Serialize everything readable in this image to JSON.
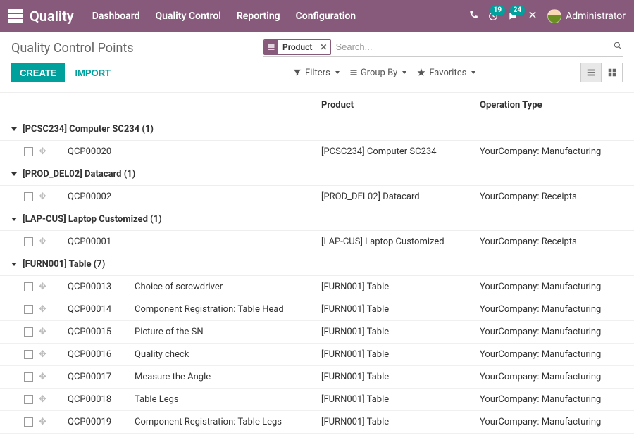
{
  "navbar": {
    "brand": "Quality",
    "menu": [
      "Dashboard",
      "Quality Control",
      "Reporting",
      "Configuration"
    ],
    "badge_activities": "19",
    "badge_messages": "24",
    "user_name": "Administrator"
  },
  "page": {
    "title": "Quality Control Points",
    "facet_label": "Product",
    "search_placeholder": "Search..."
  },
  "buttons": {
    "create": "CREATE",
    "import": "IMPORT",
    "filters": "Filters",
    "group_by": "Group By",
    "favorites": "Favorites"
  },
  "columns": {
    "product": "Product",
    "operation_type": "Operation Type"
  },
  "groups": [
    {
      "label": "[PCSC234] Computer SC234 (1)",
      "rows": [
        {
          "ref": "QCP00020",
          "title": "",
          "product": "[PCSC234] Computer SC234",
          "op": "YourCompany: Manufacturing"
        }
      ]
    },
    {
      "label": "[PROD_DEL02] Datacard (1)",
      "rows": [
        {
          "ref": "QCP00002",
          "title": "",
          "product": "[PROD_DEL02] Datacard",
          "op": "YourCompany: Receipts"
        }
      ]
    },
    {
      "label": "[LAP-CUS] Laptop Customized (1)",
      "rows": [
        {
          "ref": "QCP00001",
          "title": "",
          "product": "[LAP-CUS] Laptop Customized",
          "op": "YourCompany: Receipts"
        }
      ]
    },
    {
      "label": "[FURN001] Table (7)",
      "rows": [
        {
          "ref": "QCP00013",
          "title": "Choice of screwdriver",
          "product": "[FURN001] Table",
          "op": "YourCompany: Manufacturing"
        },
        {
          "ref": "QCP00014",
          "title": "Component Registration: Table Head",
          "product": "[FURN001] Table",
          "op": "YourCompany: Manufacturing"
        },
        {
          "ref": "QCP00015",
          "title": "Picture of the SN",
          "product": "[FURN001] Table",
          "op": "YourCompany: Manufacturing"
        },
        {
          "ref": "QCP00016",
          "title": "Quality check",
          "product": "[FURN001] Table",
          "op": "YourCompany: Manufacturing"
        },
        {
          "ref": "QCP00017",
          "title": "Measure the Angle",
          "product": "[FURN001] Table",
          "op": "YourCompany: Manufacturing"
        },
        {
          "ref": "QCP00018",
          "title": "Table Legs",
          "product": "[FURN001] Table",
          "op": "YourCompany: Manufacturing"
        },
        {
          "ref": "QCP00019",
          "title": "Component Registration: Table Legs",
          "product": "[FURN001] Table",
          "op": "YourCompany: Manufacturing"
        }
      ]
    }
  ]
}
